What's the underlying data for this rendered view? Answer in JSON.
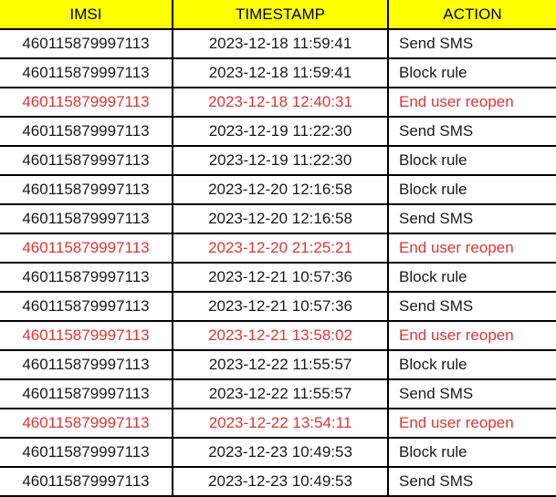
{
  "table": {
    "columns": [
      {
        "key": "imsi",
        "label": "IMSI",
        "align": "center"
      },
      {
        "key": "timestamp",
        "label": "TIMESTAMP",
        "align": "center"
      },
      {
        "key": "action",
        "label": "ACTION",
        "align": "left"
      }
    ],
    "header_background": "#FFFF00",
    "header_text_color": "#000000",
    "body_text_color": "#1a1a1a",
    "highlight_text_color": "#e03535",
    "border_color": "#000000",
    "rows": [
      {
        "imsi": "460115879997113",
        "timestamp": "2023-12-18 11:59:41",
        "action": "Send SMS",
        "highlight": false
      },
      {
        "imsi": "460115879997113",
        "timestamp": "2023-12-18 11:59:41",
        "action": "Block rule",
        "highlight": false
      },
      {
        "imsi": "460115879997113",
        "timestamp": "2023-12-18 12:40:31",
        "action": "End user reopen",
        "highlight": true
      },
      {
        "imsi": "460115879997113",
        "timestamp": "2023-12-19 11:22:30",
        "action": "Send SMS",
        "highlight": false
      },
      {
        "imsi": "460115879997113",
        "timestamp": "2023-12-19 11:22:30",
        "action": "Block rule",
        "highlight": false
      },
      {
        "imsi": "460115879997113",
        "timestamp": "2023-12-20 12:16:58",
        "action": "Block rule",
        "highlight": false
      },
      {
        "imsi": "460115879997113",
        "timestamp": "2023-12-20 12:16:58",
        "action": "Send SMS",
        "highlight": false
      },
      {
        "imsi": "460115879997113",
        "timestamp": "2023-12-20 21:25:21",
        "action": "End user reopen",
        "highlight": true
      },
      {
        "imsi": "460115879997113",
        "timestamp": "2023-12-21 10:57:36",
        "action": "Block rule",
        "highlight": false
      },
      {
        "imsi": "460115879997113",
        "timestamp": "2023-12-21 10:57:36",
        "action": "Send SMS",
        "highlight": false
      },
      {
        "imsi": "460115879997113",
        "timestamp": "2023-12-21 13:58:02",
        "action": "End user reopen",
        "highlight": true
      },
      {
        "imsi": "460115879997113",
        "timestamp": "2023-12-22 11:55:57",
        "action": "Block rule",
        "highlight": false
      },
      {
        "imsi": "460115879997113",
        "timestamp": "2023-12-22 11:55:57",
        "action": "Send SMS",
        "highlight": false
      },
      {
        "imsi": "460115879997113",
        "timestamp": "2023-12-22 13:54:11",
        "action": "End user reopen",
        "highlight": true
      },
      {
        "imsi": "460115879997113",
        "timestamp": "2023-12-23 10:49:53",
        "action": "Block rule",
        "highlight": false
      },
      {
        "imsi": "460115879997113",
        "timestamp": "2023-12-23 10:49:53",
        "action": "Send SMS",
        "highlight": false
      }
    ]
  }
}
